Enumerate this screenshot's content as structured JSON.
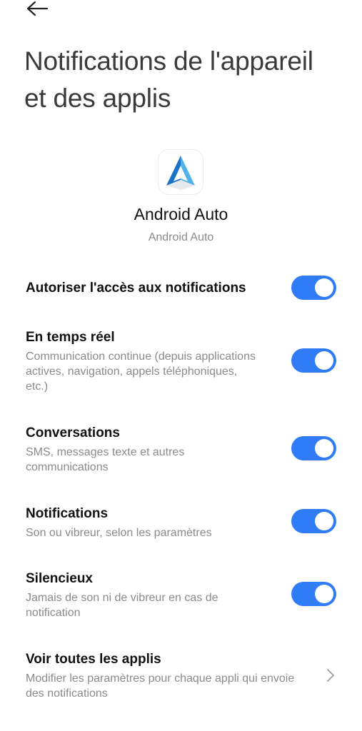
{
  "header": {
    "back_icon": "arrow-left-icon",
    "title": "Notifications de l'appareil et des applis"
  },
  "app": {
    "icon": "android-auto-icon",
    "name": "Android Auto",
    "package_label": "Android Auto"
  },
  "settings": {
    "allow_access": {
      "title": "Autoriser l'accès aux notifications",
      "enabled": true
    },
    "real_time": {
      "title": "En temps réel",
      "description": "Communication continue (depuis applications actives, navigation, appels téléphoniques, etc.)",
      "enabled": true
    },
    "conversations": {
      "title": "Conversations",
      "description": "SMS, messages texte et autres communications",
      "enabled": true
    },
    "notifications": {
      "title": "Notifications",
      "description": "Son ou vibreur, selon les paramètres",
      "enabled": true
    },
    "silent": {
      "title": "Silencieux",
      "description": "Jamais de son ni de vibreur en cas de notification",
      "enabled": true
    },
    "see_all_apps": {
      "title": "Voir toutes les applis",
      "description": "Modifier les paramètres pour chaque appli qui envoie des notifications",
      "icon": "chevron-right-icon"
    }
  },
  "colors": {
    "accent": "#2f7cf6",
    "text_primary": "#111111",
    "text_secondary": "#8a8a8a",
    "title": "#3a3a3a"
  }
}
